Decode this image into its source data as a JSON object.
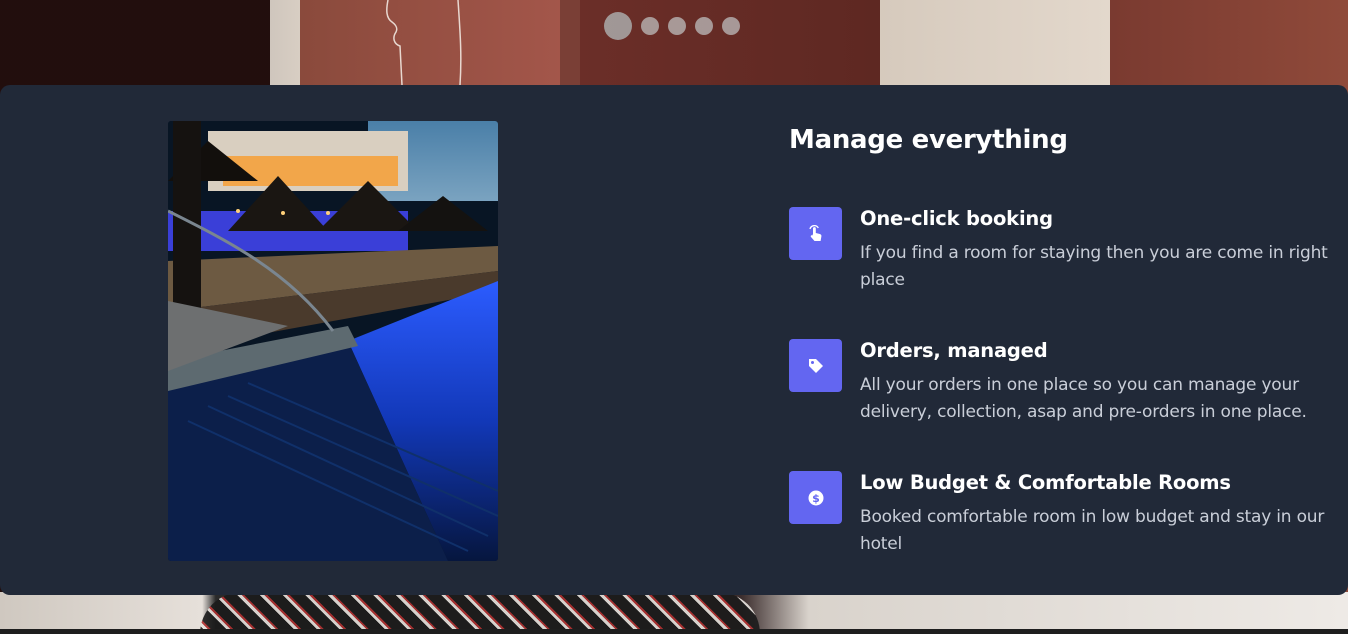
{
  "slider": {
    "total_slides": 5,
    "active_index": 0
  },
  "section": {
    "heading": "Manage everything",
    "image_alt_icon": "pool-photo",
    "features": [
      {
        "icon": "touch-icon",
        "title": "One-click booking",
        "description": "If you find a room for staying then you are come in right place"
      },
      {
        "icon": "tag-icon",
        "title": "Orders, managed",
        "description": "All your orders in one place so you can manage your delivery, collection, asap and pre-orders in one place."
      },
      {
        "icon": "dollar-badge-icon",
        "title": "Low Budget & Comfortable Rooms",
        "description": "Booked comfortable room in low budget and stay in our hotel"
      }
    ]
  },
  "colors": {
    "card_background": "#212938",
    "accent": "#6366f1",
    "heading": "#ffffff",
    "body_text": "#c9ced8"
  }
}
